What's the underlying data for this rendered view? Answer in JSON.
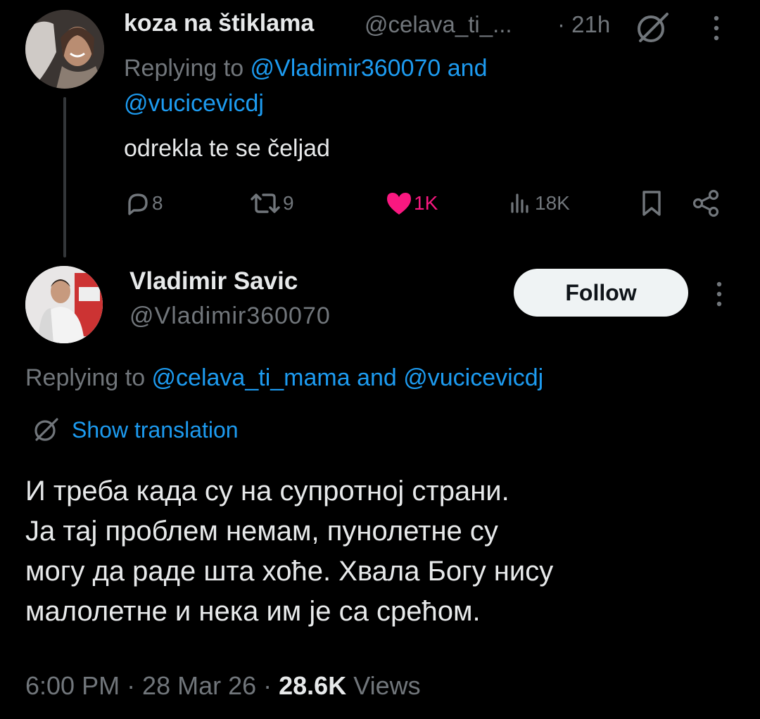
{
  "colors": {
    "background": "#000000",
    "text": "#e7e9ea",
    "muted": "#71767b",
    "link": "#1d9bf0",
    "like": "#f91880",
    "follow_bg": "#eff3f4"
  },
  "tweet1": {
    "name": "koza na štiklama",
    "handle": "@celava_ti_...",
    "time": "· 21h",
    "reply_prefix": "Replying to ",
    "reply_to_1": "@Vladimir360070",
    "reply_and": " and",
    "reply_to_2": "@vucicevicdj",
    "text": "odrekla te se čeljad",
    "actions": {
      "replies": "8",
      "reposts": "9",
      "likes": "1K",
      "views": "18K"
    },
    "icons": [
      "grok-icon",
      "more-icon",
      "reply-icon",
      "repost-icon",
      "heart-icon",
      "views-icon",
      "bookmark-icon",
      "share-icon"
    ]
  },
  "tweet2": {
    "name": "Vladimir Savic",
    "handle": "@Vladimir360070",
    "follow_label": "Follow",
    "reply_prefix": "Replying to ",
    "reply_to_1": "@celava_ti_mama",
    "reply_and": " and ",
    "reply_to_2": "@vucicevicdj",
    "translate_label": "Show translation",
    "body_lines": [
      "И треба када су на супротној страни.",
      "Ја тај проблем немам, пунолетне су",
      "могу да раде шта хоће. Хвала Богу нису",
      "малолетне и нека им је са срећом."
    ],
    "meta_time": "6:00 PM · 28 Mar 26 · ",
    "meta_views": "28.6K",
    "meta_views_label": " Views"
  }
}
